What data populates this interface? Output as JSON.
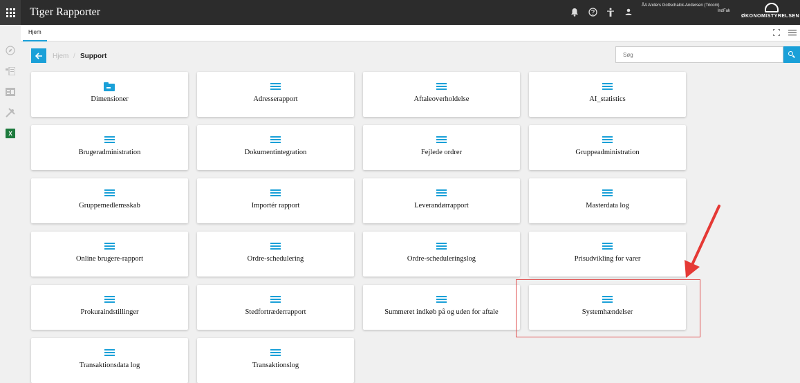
{
  "app": {
    "title": "Tiger Rapporter"
  },
  "user": {
    "name": "ÅA Anders Gottschalck-Andersen (Tricom)",
    "org": "IndFak"
  },
  "logo": {
    "text": "ØKONOMISTYRELSEN"
  },
  "tabs": [
    {
      "label": "Hjem"
    }
  ],
  "breadcrumb": {
    "home": "Hjem",
    "separator": "/",
    "current": "Support"
  },
  "search": {
    "placeholder": "Søg",
    "value": ""
  },
  "colors": {
    "accent": "#1aa0d8",
    "topbar": "#2c2c2c",
    "highlight": "#e05050"
  },
  "tiles": [
    {
      "label": "Dimensioner",
      "icon": "folder-icon"
    },
    {
      "label": "Adresserapport",
      "icon": "list-icon"
    },
    {
      "label": "Aftaleoverholdelse",
      "icon": "list-icon"
    },
    {
      "label": "AI_statistics",
      "icon": "list-icon"
    },
    {
      "label": "Brugeradministration",
      "icon": "list-icon"
    },
    {
      "label": "Dokumentintegration",
      "icon": "list-icon"
    },
    {
      "label": "Fejlede ordrer",
      "icon": "list-icon"
    },
    {
      "label": "Gruppeadministration",
      "icon": "list-icon"
    },
    {
      "label": "Gruppemedlemsskab",
      "icon": "list-icon"
    },
    {
      "label": "Importér rapport",
      "icon": "list-icon"
    },
    {
      "label": "Leverandørrapport",
      "icon": "list-icon"
    },
    {
      "label": "Masterdata log",
      "icon": "list-icon"
    },
    {
      "label": "Online brugere-rapport",
      "icon": "list-icon"
    },
    {
      "label": "Ordre-schedulering",
      "icon": "list-icon"
    },
    {
      "label": "Ordre-scheduleringslog",
      "icon": "list-icon"
    },
    {
      "label": "Prisudvikling for varer",
      "icon": "list-icon"
    },
    {
      "label": "Prokuraindstillinger",
      "icon": "list-icon"
    },
    {
      "label": "Stedfortræderrapport",
      "icon": "list-icon"
    },
    {
      "label": "Summeret indkøb på og uden for aftale",
      "icon": "list-icon"
    },
    {
      "label": "Systemhændelser",
      "icon": "list-icon",
      "highlighted": true
    },
    {
      "label": "Transaktionsdata log",
      "icon": "list-icon"
    },
    {
      "label": "Transaktionslog",
      "icon": "list-icon"
    }
  ]
}
